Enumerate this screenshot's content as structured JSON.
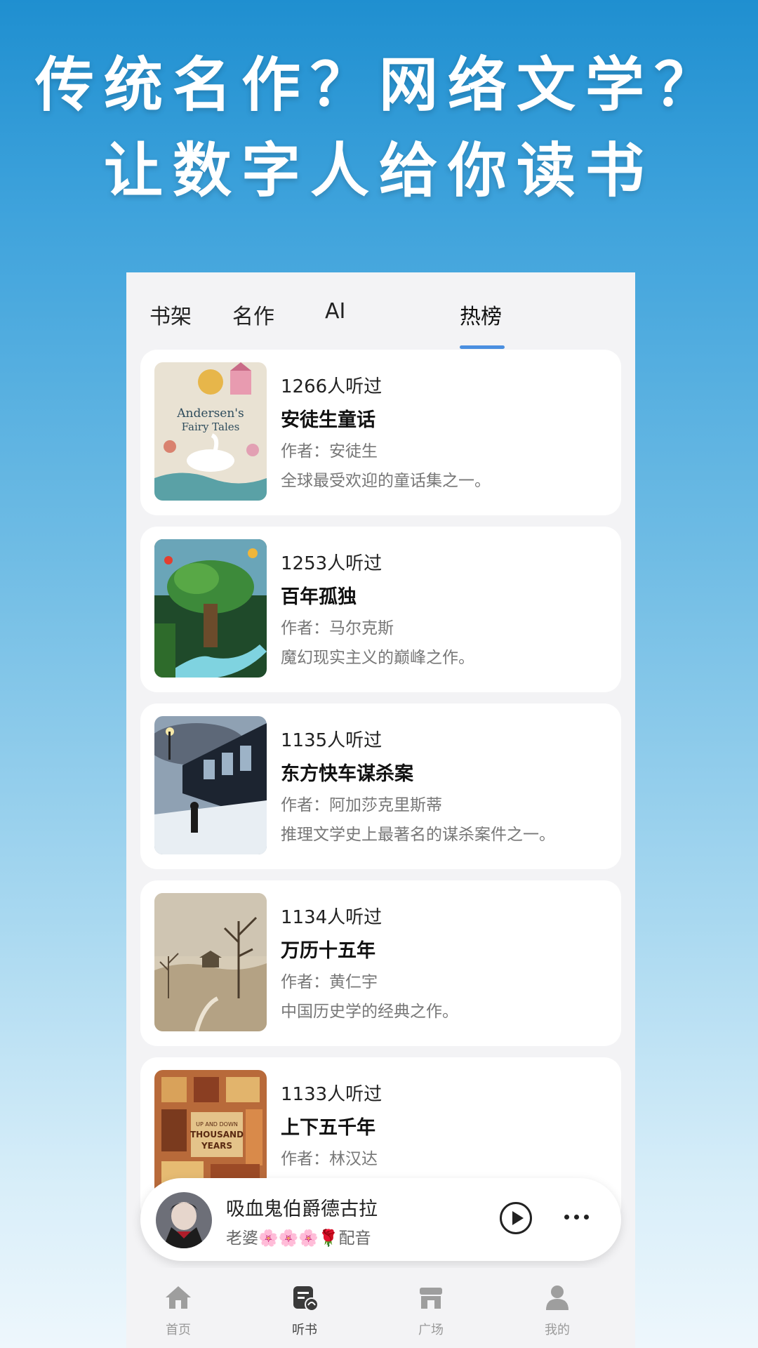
{
  "hero": {
    "line1": "传统名作？网络文学？",
    "line2": "让数字人给你读书"
  },
  "tabs": [
    {
      "label": "书架",
      "active": false
    },
    {
      "label": "名作",
      "active": false
    },
    {
      "label": "AI",
      "active": false
    },
    {
      "label": "热榜",
      "active": true
    }
  ],
  "books": [
    {
      "listens": "1266人听过",
      "title": "安徒生童话",
      "author": "作者：安徒生",
      "desc": "全球最受欢迎的童话集之一。",
      "cover_text_1": "Andersen's",
      "cover_text_2": "Fairy Tales"
    },
    {
      "listens": "1253人听过",
      "title": "百年孤独",
      "author": "作者：马尔克斯",
      "desc": "魔幻现实主义的巅峰之作。"
    },
    {
      "listens": "1135人听过",
      "title": "东方快车谋杀案",
      "author": "作者：阿加莎克里斯蒂",
      "desc": "推理文学史上最著名的谋杀案件之一。"
    },
    {
      "listens": "1134人听过",
      "title": "万历十五年",
      "author": "作者：黄仁宇",
      "desc": "中国历史学的经典之作。"
    },
    {
      "listens": "1133人听过",
      "title": "上下五千年",
      "author": "作者：林汉达",
      "desc": "",
      "cover_text_1": "UP AND DOWN",
      "cover_text_2": "THOUSAND",
      "cover_text_3": "YEARS"
    }
  ],
  "player": {
    "title": "吸血鬼伯爵德古拉",
    "subtitle": "老婆🌸🌸🌸🌹配音"
  },
  "nav": [
    {
      "label": "首页",
      "icon": "home-icon",
      "active": false
    },
    {
      "label": "听书",
      "icon": "audiobook-icon",
      "active": true
    },
    {
      "label": "广场",
      "icon": "store-icon",
      "active": false
    },
    {
      "label": "我的",
      "icon": "profile-icon",
      "active": false
    }
  ],
  "colors": {
    "accent": "#4a8fe0",
    "background_top": "#1f8fd0",
    "background_bottom": "#eef7fc"
  }
}
